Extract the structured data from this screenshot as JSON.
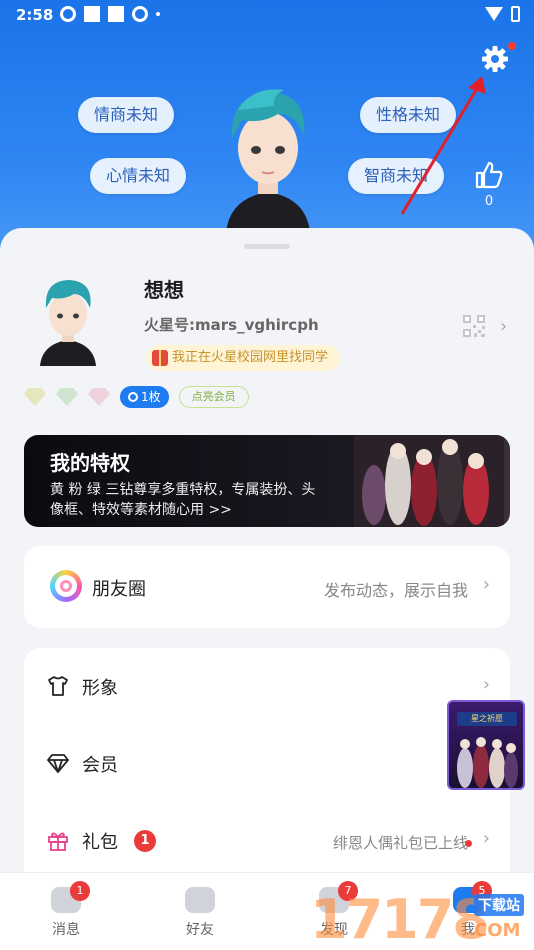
{
  "status_bar": {
    "time": "2:58"
  },
  "hero": {
    "bubbles": [
      "情商未知",
      "性格未知",
      "心情未知",
      "智商未知"
    ],
    "like_count": "0"
  },
  "profile": {
    "nickname": "想想",
    "user_id": "火星号:mars_vghircph",
    "campus_tag": "我正在火星校园网里找同学",
    "medal_label": "1枚",
    "vip_tag": "点亮会员"
  },
  "privilege": {
    "title": "我的特权",
    "description": "黄 粉 绿 三钻尊享多重特权，专属装扮、头像框、特效等素材随心用 >>"
  },
  "moments": {
    "label": "朋友圈",
    "subtitle": "发布动态，展示自我"
  },
  "menu": {
    "items": [
      {
        "label": "形象",
        "icon": "shirt-icon"
      },
      {
        "label": "会员",
        "icon": "diamond-icon"
      },
      {
        "label": "礼包",
        "icon": "gift-icon",
        "badge": "1",
        "note": "绯恩人偶礼包已上线"
      }
    ]
  },
  "float_promo": {
    "banner": "星之祈愿"
  },
  "tabbar": {
    "tabs": [
      {
        "label": "消息",
        "badge": "1"
      },
      {
        "label": "好友",
        "badge": ""
      },
      {
        "label": "发现",
        "badge": "7"
      },
      {
        "label": "我",
        "badge": "5"
      }
    ]
  },
  "watermark": {
    "number": "17178",
    "site": "下载站",
    "domain": "COM"
  },
  "colors": {
    "primary": "#1e7bf0",
    "badge_red": "#ea3a3a",
    "arrow_red": "#e0202a"
  }
}
